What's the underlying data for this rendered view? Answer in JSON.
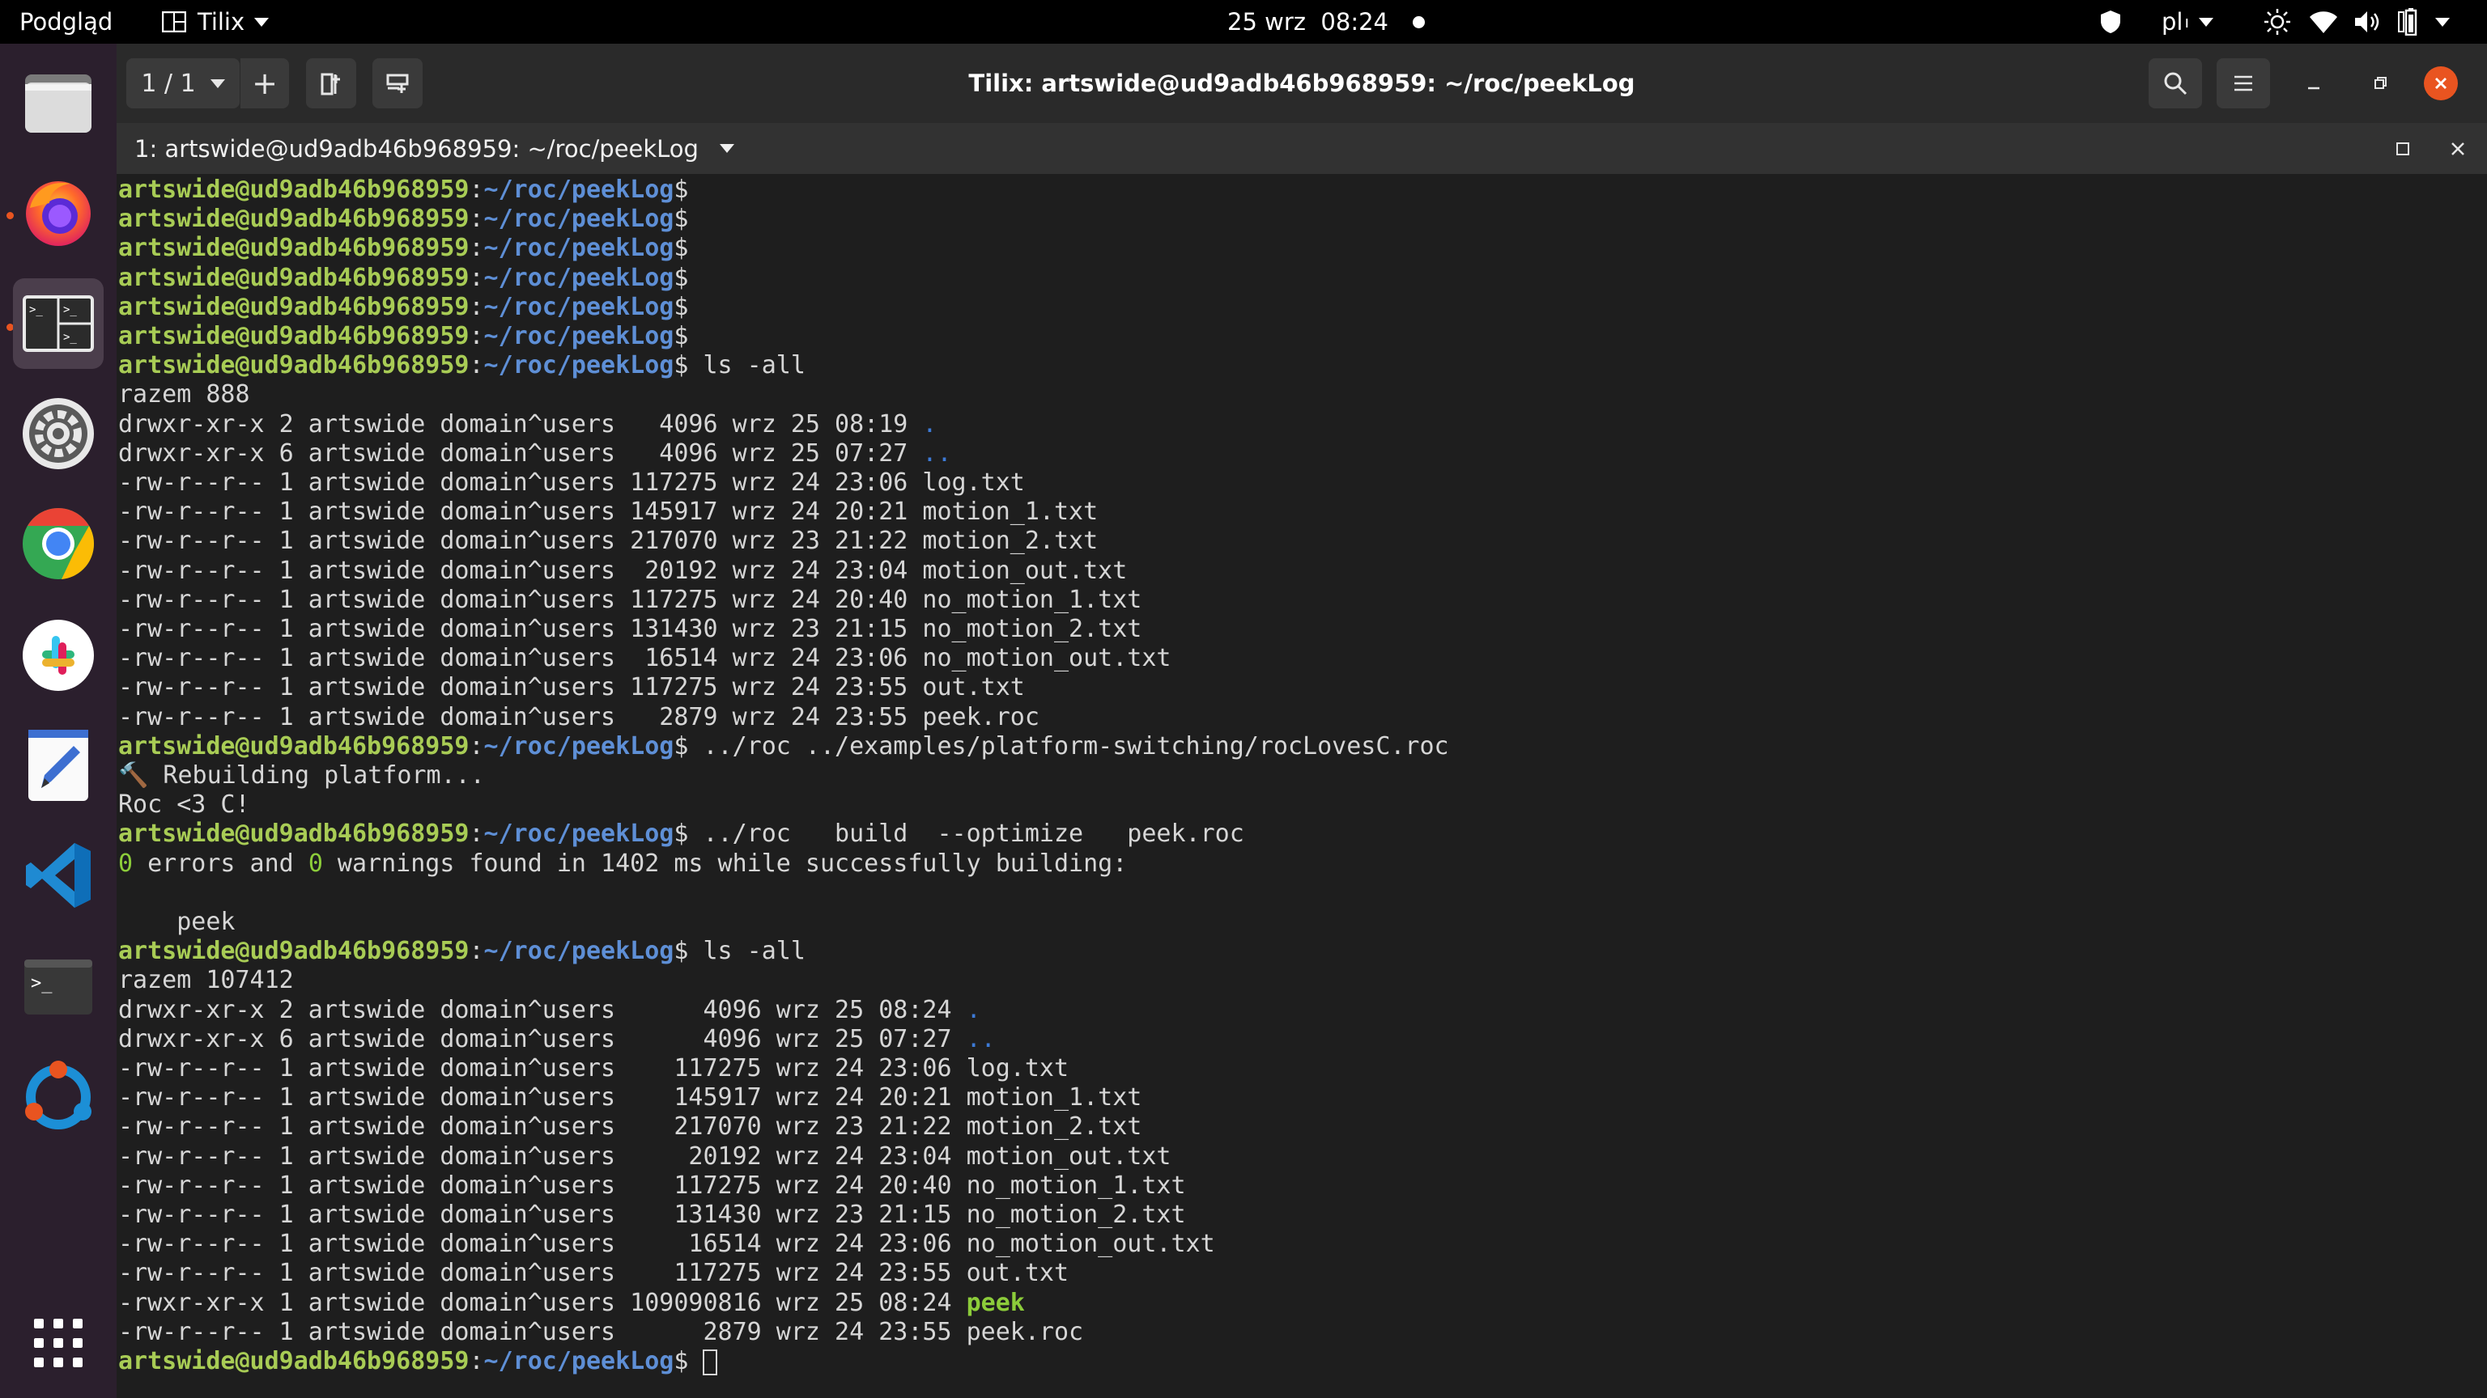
{
  "topbar": {
    "activities": "Podgląd",
    "app_menu": "Tilix",
    "clock": "25 wrz  08:24",
    "keyboard_layout": "pl"
  },
  "dock": {
    "items": [
      {
        "name": "files",
        "icon": "folder-icon"
      },
      {
        "name": "firefox",
        "icon": "firefox-icon"
      },
      {
        "name": "tilix",
        "icon": "terminal-icon"
      },
      {
        "name": "settings",
        "icon": "gear-icon"
      },
      {
        "name": "chrome",
        "icon": "chrome-icon"
      },
      {
        "name": "slack",
        "icon": "slack-icon"
      },
      {
        "name": "text-editor",
        "icon": "pencil-icon"
      },
      {
        "name": "vscode",
        "icon": "vscode-icon"
      },
      {
        "name": "terminal",
        "icon": "terminal-icon"
      },
      {
        "name": "ubuntu-software",
        "icon": "ubuntu-icon"
      },
      {
        "name": "show-apps",
        "icon": "grid-icon"
      }
    ]
  },
  "window": {
    "session_counter": "1 / 1",
    "title": "Tilix: artswide@ud9adb46b968959: ~/roc/peekLog",
    "session_tab": "1: artswide@ud9adb46b968959: ~/roc/peekLog"
  },
  "terminal": {
    "user": "artswide@ud9adb46b968959",
    "path": "~/roc/peekLog",
    "lines": [
      {
        "t": "prompt",
        "cmd": ""
      },
      {
        "t": "prompt",
        "cmd": ""
      },
      {
        "t": "prompt",
        "cmd": ""
      },
      {
        "t": "prompt",
        "cmd": ""
      },
      {
        "t": "prompt",
        "cmd": ""
      },
      {
        "t": "prompt",
        "cmd": ""
      },
      {
        "t": "prompt",
        "cmd": " ls -all"
      },
      {
        "t": "text",
        "text": "razem 888"
      },
      {
        "t": "ls",
        "meta": "drwxr-xr-x 2 artswide domain^users   4096 wrz 25 08:19 ",
        "name": ".",
        "cls": "d"
      },
      {
        "t": "ls",
        "meta": "drwxr-xr-x 6 artswide domain^users   4096 wrz 25 07:27 ",
        "name": "..",
        "cls": "d"
      },
      {
        "t": "ls",
        "meta": "-rw-r--r-- 1 artswide domain^users 117275 wrz 24 23:06 ",
        "name": "log.txt",
        "cls": ""
      },
      {
        "t": "ls",
        "meta": "-rw-r--r-- 1 artswide domain^users 145917 wrz 24 20:21 ",
        "name": "motion_1.txt",
        "cls": ""
      },
      {
        "t": "ls",
        "meta": "-rw-r--r-- 1 artswide domain^users 217070 wrz 23 21:22 ",
        "name": "motion_2.txt",
        "cls": ""
      },
      {
        "t": "ls",
        "meta": "-rw-r--r-- 1 artswide domain^users  20192 wrz 24 23:04 ",
        "name": "motion_out.txt",
        "cls": ""
      },
      {
        "t": "ls",
        "meta": "-rw-r--r-- 1 artswide domain^users 117275 wrz 24 20:40 ",
        "name": "no_motion_1.txt",
        "cls": ""
      },
      {
        "t": "ls",
        "meta": "-rw-r--r-- 1 artswide domain^users 131430 wrz 23 21:15 ",
        "name": "no_motion_2.txt",
        "cls": ""
      },
      {
        "t": "ls",
        "meta": "-rw-r--r-- 1 artswide domain^users  16514 wrz 24 23:06 ",
        "name": "no_motion_out.txt",
        "cls": ""
      },
      {
        "t": "ls",
        "meta": "-rw-r--r-- 1 artswide domain^users 117275 wrz 24 23:55 ",
        "name": "out.txt",
        "cls": ""
      },
      {
        "t": "ls",
        "meta": "-rw-r--r-- 1 artswide domain^users   2879 wrz 24 23:55 ",
        "name": "peek.roc",
        "cls": ""
      },
      {
        "t": "prompt",
        "cmd": " ../roc ../examples/platform-switching/rocLovesC.roc"
      },
      {
        "t": "text",
        "text": "🔨 Rebuilding platform..."
      },
      {
        "t": "text",
        "text": "Roc <3 C!"
      },
      {
        "t": "prompt",
        "cmd": " ../roc   build  --optimize   peek.roc"
      },
      {
        "t": "summary",
        "e": "0",
        "a": " errors and ",
        "w": "0",
        "b": " warnings found in 1402 ms while successfully building:"
      },
      {
        "t": "text",
        "text": ""
      },
      {
        "t": "text",
        "text": "    peek"
      },
      {
        "t": "prompt",
        "cmd": " ls -all"
      },
      {
        "t": "text",
        "text": "razem 107412"
      },
      {
        "t": "ls",
        "meta": "drwxr-xr-x 2 artswide domain^users      4096 wrz 25 08:24 ",
        "name": ".",
        "cls": "d"
      },
      {
        "t": "ls",
        "meta": "drwxr-xr-x 6 artswide domain^users      4096 wrz 25 07:27 ",
        "name": "..",
        "cls": "d"
      },
      {
        "t": "ls",
        "meta": "-rw-r--r-- 1 artswide domain^users    117275 wrz 24 23:06 ",
        "name": "log.txt",
        "cls": ""
      },
      {
        "t": "ls",
        "meta": "-rw-r--r-- 1 artswide domain^users    145917 wrz 24 20:21 ",
        "name": "motion_1.txt",
        "cls": ""
      },
      {
        "t": "ls",
        "meta": "-rw-r--r-- 1 artswide domain^users    217070 wrz 23 21:22 ",
        "name": "motion_2.txt",
        "cls": ""
      },
      {
        "t": "ls",
        "meta": "-rw-r--r-- 1 artswide domain^users     20192 wrz 24 23:04 ",
        "name": "motion_out.txt",
        "cls": ""
      },
      {
        "t": "ls",
        "meta": "-rw-r--r-- 1 artswide domain^users    117275 wrz 24 20:40 ",
        "name": "no_motion_1.txt",
        "cls": ""
      },
      {
        "t": "ls",
        "meta": "-rw-r--r-- 1 artswide domain^users    131430 wrz 23 21:15 ",
        "name": "no_motion_2.txt",
        "cls": ""
      },
      {
        "t": "ls",
        "meta": "-rw-r--r-- 1 artswide domain^users     16514 wrz 24 23:06 ",
        "name": "no_motion_out.txt",
        "cls": ""
      },
      {
        "t": "ls",
        "meta": "-rw-r--r-- 1 artswide domain^users    117275 wrz 24 23:55 ",
        "name": "out.txt",
        "cls": ""
      },
      {
        "t": "ls",
        "meta": "-rwxr-xr-x 1 artswide domain^users 109090816 wrz 25 08:24 ",
        "name": "peek",
        "cls": "x"
      },
      {
        "t": "ls",
        "meta": "-rw-r--r-- 1 artswide domain^users      2879 wrz 24 23:55 ",
        "name": "peek.roc",
        "cls": ""
      },
      {
        "t": "prompt_cursor",
        "cmd": " "
      }
    ]
  }
}
